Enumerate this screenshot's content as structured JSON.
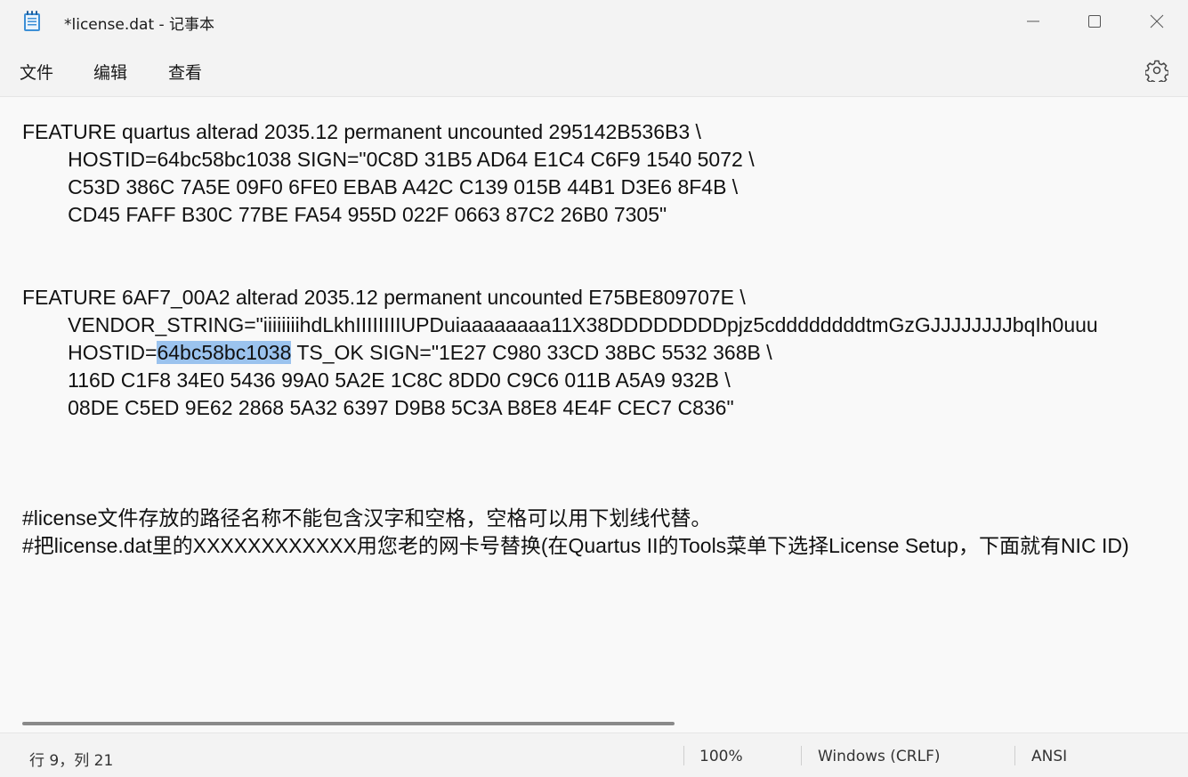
{
  "window": {
    "title": "*license.dat - 记事本"
  },
  "menu": {
    "items": [
      "文件",
      "编辑",
      "查看"
    ]
  },
  "icons": {
    "app": "notepad-icon",
    "minimize": "minimize-icon",
    "maximize": "maximize-icon",
    "close": "close-icon",
    "settings": "gear-icon"
  },
  "editor": {
    "selected_text": "64bc58bc1038",
    "lines": [
      "FEATURE quartus alterad 2035.12 permanent uncounted 295142B536B3 \\",
      "\tHOSTID=64bc58bc1038 SIGN=\"0C8D 31B5 AD64 E1C4 C6F9 1540 5072 \\",
      "\tC53D 386C 7A5E 09F0 6FE0 EBAB A42C C139 015B 44B1 D3E6 8F4B \\",
      "\tCD45 FAFF B30C 77BE FA54 955D 022F 0663 87C2 26B0 7305\"",
      "",
      "",
      "FEATURE 6AF7_00A2 alterad 2035.12 permanent uncounted E75BE809707E \\",
      "\tVENDOR_STRING=\"iiiiiiiihdLkhIIIIIIIIUPDuiaaaaaaaa11X38DDDDDDDDpjz5cddddddddtmGzGJJJJJJJJbqIh0uuu",
      "\tHOSTID=64bc58bc1038 TS_OK SIGN=\"1E27 C980 33CD 38BC 5532 368B \\",
      "\t116D C1F8 34E0 5436 99A0 5A2E 1C8C 8DD0 C9C6 011B A5A9 932B \\",
      "\t08DE C5ED 9E62 2868 5A32 6397 D9B8 5C3A B8E8 4E4F CEC7 C836\"",
      "",
      "",
      "",
      "#license文件存放的路径名称不能包含汉字和空格，空格可以用下划线代替。",
      "#把license.dat里的XXXXXXXXXXXX用您老的网卡号替换(在Quartus II的Tools菜单下选择License Setup，下面就有NIC ID)"
    ]
  },
  "status": {
    "cursor": "行 9，列 21",
    "zoom": "100%",
    "line_ending": "Windows (CRLF)",
    "encoding": "ANSI"
  }
}
